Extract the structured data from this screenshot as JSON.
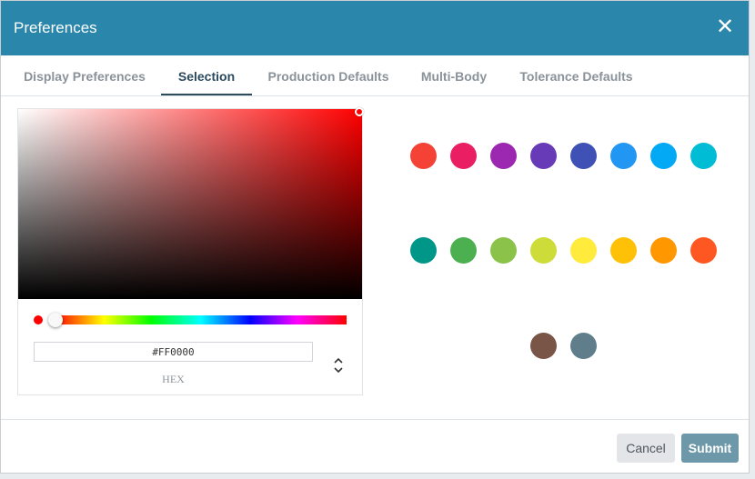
{
  "dialog": {
    "title": "Preferences",
    "close_label": "✕"
  },
  "tabs": [
    {
      "label": "Display Preferences",
      "active": false
    },
    {
      "label": "Selection",
      "active": true
    },
    {
      "label": "Production Defaults",
      "active": false
    },
    {
      "label": "Multi-Body",
      "active": false
    },
    {
      "label": "Tolerance Defaults",
      "active": false
    }
  ],
  "picker": {
    "hex_value": "#FF0000",
    "mode_label": "HEX",
    "current_color": "#FF0000",
    "hue": 0,
    "saturation": 1,
    "brightness": 1
  },
  "swatches": [
    "#f44336",
    "#e91e63",
    "#9c27b0",
    "#673ab7",
    "#3f51b5",
    "#2196f3",
    "#03a9f4",
    "#00bcd4",
    "#009688",
    "#4caf50",
    "#8bc34a",
    "#cddc39",
    "#ffeb3b",
    "#ffc107",
    "#ff9800",
    "#ff5722",
    "#795548",
    "#607d8b"
  ],
  "footer": {
    "cancel_label": "Cancel",
    "submit_label": "Submit"
  },
  "colors": {
    "header_bg": "#2a86ab",
    "tab_active": "#2c4a5e",
    "submit_bg": "#6d98a9"
  }
}
